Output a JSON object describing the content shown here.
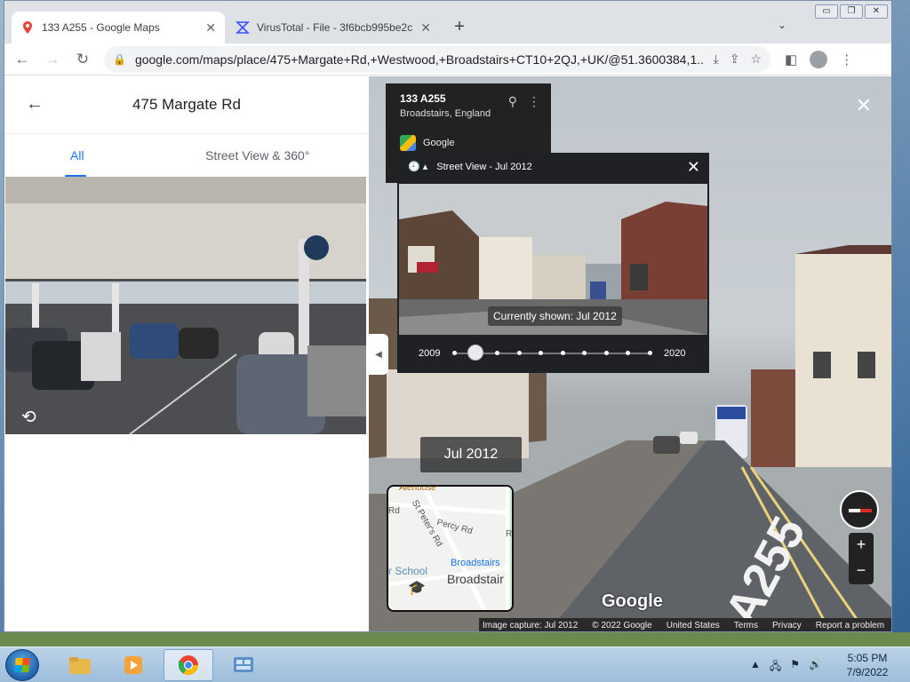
{
  "browser": {
    "tabs": [
      {
        "title": "133 A255 - Google Maps",
        "active": true
      },
      {
        "title": "VirusTotal - File - 3f6bcb995be2c",
        "active": false
      }
    ],
    "new_tab_symbol": "+",
    "tab_menu_symbol": "⌄",
    "window_controls": [
      "▭",
      "❐",
      "✕"
    ],
    "url": "google.com/maps/place/475+Margate+Rd,+Westwood,+Broadstairs+CT10+2QJ,+UK/@51.3600384,1...."
  },
  "left_panel": {
    "title": "475 Margate Rd",
    "tabs": [
      "All",
      "Street View & 360°"
    ]
  },
  "street_view": {
    "card": {
      "title": "133 A255",
      "subtitle": "Broadstairs, England",
      "provider": "Google"
    },
    "time_machine": {
      "label": "Street View - Jul 2012",
      "caption": "Currently shown: Jul 2012",
      "year_start": "2009",
      "year_end": "2020",
      "stops": 10,
      "selected_stop": 1
    },
    "date_label": "Jul 2012",
    "minimap": {
      "labels": [
        "Alehouse",
        "St Peter's Rd",
        "Percy Rd",
        "r School",
        "Broadstairs",
        "Broadstair",
        "Rd",
        "R"
      ]
    },
    "logo": "Google",
    "footer": [
      "Image capture: Jul 2012",
      "© 2022 Google",
      "United States",
      "Terms",
      "Privacy",
      "Report a problem"
    ]
  },
  "taskbar": {
    "time": "5:05 PM",
    "date": "7/9/2022"
  },
  "colors": {
    "accent": "#1a73e8",
    "tab_bar": "#dee1e6",
    "panel_dark": "#202124"
  }
}
